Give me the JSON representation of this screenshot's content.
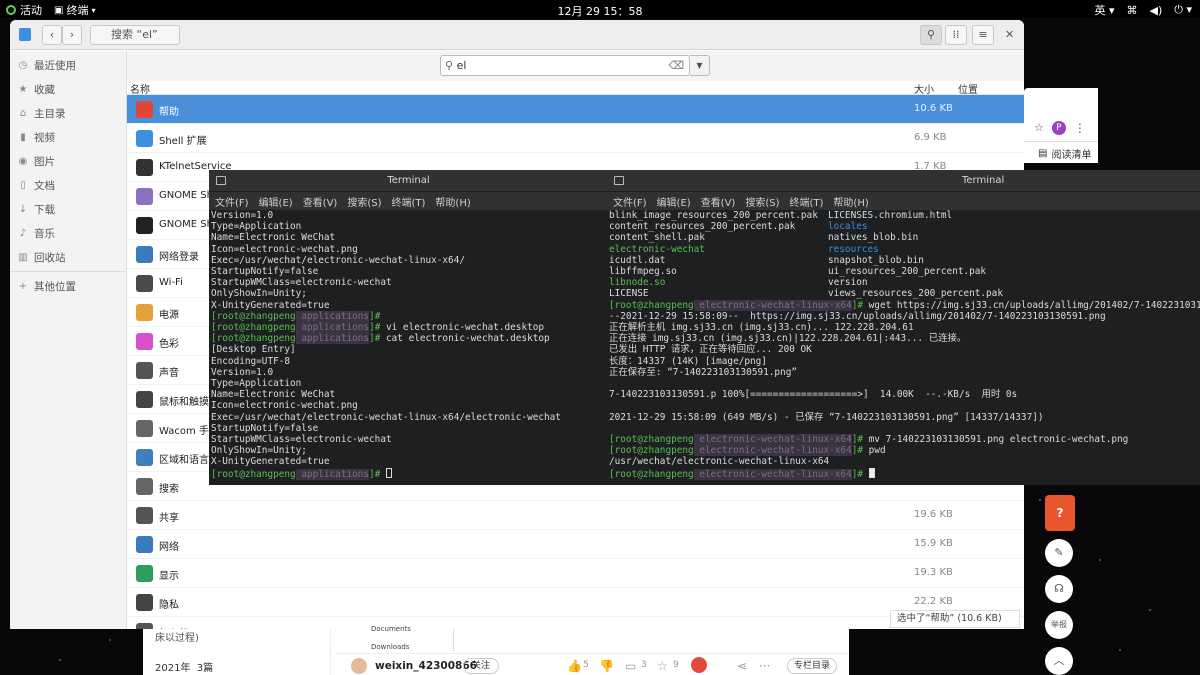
{
  "topbar": {
    "activities": "活动",
    "app": "终端",
    "clock": "12月 29 15：58",
    "lang": "英"
  },
  "browser": {
    "reading_list": "阅读清单",
    "avatar": "P"
  },
  "filemanager": {
    "location": "搜索 “el”",
    "search_value": "el",
    "columns": {
      "name": "名称",
      "size": "大小",
      "location": "位置"
    },
    "sidebar": [
      {
        "label": "最近使用",
        "icon": "clock-icon"
      },
      {
        "label": "收藏",
        "icon": "star-icon"
      },
      {
        "label": "主目录",
        "icon": "home-icon"
      },
      {
        "label": "视频",
        "icon": "video-icon"
      },
      {
        "label": "图片",
        "icon": "camera-icon"
      },
      {
        "label": "文档",
        "icon": "document-icon"
      },
      {
        "label": "下载",
        "icon": "download-icon"
      },
      {
        "label": "音乐",
        "icon": "music-icon"
      },
      {
        "label": "回收站",
        "icon": "trash-icon"
      },
      {
        "label": "其他位置",
        "icon": "plus-icon"
      }
    ],
    "rows": [
      {
        "name": "帮助",
        "size": "10.6 KB",
        "color": "#e0463a",
        "selected": true
      },
      {
        "name": "Shell 扩展",
        "size": "6.9 KB",
        "color": "#3d8fe0"
      },
      {
        "name": "KTelnetService",
        "size": "1.7 KB",
        "color": "#333333"
      },
      {
        "name": "GNOME She",
        "size": "",
        "color": "#8d6fc0"
      },
      {
        "name": "GNOME She",
        "size": "",
        "color": "#222222"
      },
      {
        "name": "网络登录",
        "size": "",
        "color": "#3a7bbf"
      },
      {
        "name": "Wi-Fi",
        "size": "",
        "color": "#4a4a4a"
      },
      {
        "name": "电源",
        "size": "",
        "color": "#e6a23a"
      },
      {
        "name": "色彩",
        "size": "",
        "color": "#d94ec9"
      },
      {
        "name": "声音",
        "size": "",
        "color": "#555555"
      },
      {
        "name": "鼠标和触摸",
        "size": "",
        "color": "#444444"
      },
      {
        "name": "Wacom 手写",
        "size": "",
        "color": "#666666"
      },
      {
        "name": "区域和语言",
        "size": "",
        "color": "#3f7fbf"
      },
      {
        "name": "搜索",
        "size": "",
        "color": "#666666"
      },
      {
        "name": "共享",
        "size": "19.6 KB",
        "color": "#555555"
      },
      {
        "name": "网络",
        "size": "15.9 KB",
        "color": "#3a7bbf"
      },
      {
        "name": "显示",
        "size": "19.3 KB",
        "color": "#2f9c5a"
      },
      {
        "name": "隐私",
        "size": "22.2 KB",
        "color": "#444444"
      },
      {
        "name": "打印机",
        "size": "",
        "color": "#555555"
      }
    ],
    "status": "选中了“帮助” (10.6 KB)"
  },
  "terminal_left": {
    "title": "Terminal",
    "menu": [
      "文件(F)",
      "编辑(E)",
      "查看(V)",
      "搜索(S)",
      "终端(T)",
      "帮助(H)"
    ],
    "lines": [
      "Version=1.0",
      "Type=Application",
      "Name=Electronic WeChat",
      "Icon=electronic-wechat.png",
      "Exec=/usr/wechat/electronic-wechat-linux-x64/",
      "StartupNotify=false",
      "StartupWMClass=electronic-wechat",
      "OnlyShowIn=Unity;",
      "X-UnityGenerated=true"
    ],
    "p1": {
      "user": "[root@zhangpeng",
      "dir": " applications",
      "end": "]#",
      "cmd": ""
    },
    "p2": {
      "user": "[root@zhangpeng",
      "dir": " applications",
      "end": "]#",
      "cmd": " vi electronic-wechat.desktop"
    },
    "p3": {
      "user": "[root@zhangpeng",
      "dir": " applications",
      "end": "]#",
      "cmd": " cat electronic-wechat.desktop"
    },
    "lines2": [
      "[Desktop Entry]",
      "Encoding=UTF-8",
      "Version=1.0",
      "Type=Application",
      "Name=Electronic WeChat",
      "Icon=electronic-wechat.png",
      "Exec=/usr/wechat/electronic-wechat-linux-x64/electronic-wechat",
      "StartupNotify=false",
      "StartupWMClass=electronic-wechat",
      "OnlyShowIn=Unity;",
      "X-UnityGenerated=true"
    ],
    "p4": {
      "user": "[root@zhangpeng",
      "dir": " applications",
      "end": "]#",
      "cmd": " "
    }
  },
  "terminal_right": {
    "title": "Terminal",
    "menu": [
      "文件(F)",
      "编辑(E)",
      "查看(V)",
      "搜索(S)",
      "终端(T)",
      "帮助(H)"
    ],
    "ls": [
      [
        "blink_image_resources_200_percent.pak",
        "LICENSES.chromium.html",
        "",
        ""
      ],
      [
        "content_resources_200_percent.pak",
        "locales",
        "",
        "blue"
      ],
      [
        "content_shell.pak",
        "natives_blob.bin",
        "",
        ""
      ],
      [
        "electronic-wechat",
        "resources",
        "green",
        "blue"
      ],
      [
        "icudtl.dat",
        "snapshot_blob.bin",
        "",
        ""
      ],
      [
        "libffmpeg.so",
        "ui_resources_200_percent.pak",
        "",
        ""
      ],
      [
        "libnode.so",
        "version",
        "green",
        ""
      ],
      [
        "LICENSE",
        "views_resources_200_percent.pak",
        "",
        ""
      ]
    ],
    "p1": {
      "user": "[root@zhangpeng",
      "dir": " electronic-wechat-linux-x64",
      "end": "]#",
      "cmd": " wget https://img.sj33.cn/uploads/allimg/201402/7-1402231031"
    },
    "lines": [
      "--2021-12-29 15:58:09--  https://img.sj33.cn/uploads/allimg/201402/7-140223103130591.png",
      "正在解析主机 img.sj33.cn (img.sj33.cn)... 122.228.204.61",
      "正在连接 img.sj33.cn (img.sj33.cn)|122.228.204.61|:443... 已连接。",
      "已发出 HTTP 请求，正在等待回应... 200 OK",
      "长度：14337 (14K) [image/png]",
      "正在保存至: “7-140223103130591.png”",
      "",
      "7-140223103130591.p 100%[===================>]  14.00K  --.-KB/s  用时 0s",
      "",
      "2021-12-29 15:58:09 (649 MB/s) - 已保存 “7-140223103130591.png” [14337/14337])",
      ""
    ],
    "p2": {
      "user": "[root@zhangpeng",
      "dir": " electronic-wechat-linux-x64",
      "end": "]#",
      "cmd": " mv 7-140223103130591.png electronic-wechat.png"
    },
    "p3": {
      "user": "[root@zhangpeng",
      "dir": " electronic-wechat-linux-x64",
      "end": "]#",
      "cmd": " pwd"
    },
    "pwd": "/usr/wechat/electronic-wechat-linux-x64",
    "p4": {
      "user": "[root@zhangpeng",
      "dir": " electronic-wechat-linux-x64",
      "end": "]#",
      "cmd": " "
    }
  },
  "web": {
    "side1": "床以过程)",
    "side2": "2021年  3篇",
    "tab1": "Documents",
    "tab2": "Downloads",
    "author": "weixin_42300866",
    "follow": "关注",
    "likes": "5",
    "comments": "3",
    "stars": "9",
    "catalog": "专栏目录"
  },
  "floats": {
    "report": "举报"
  }
}
